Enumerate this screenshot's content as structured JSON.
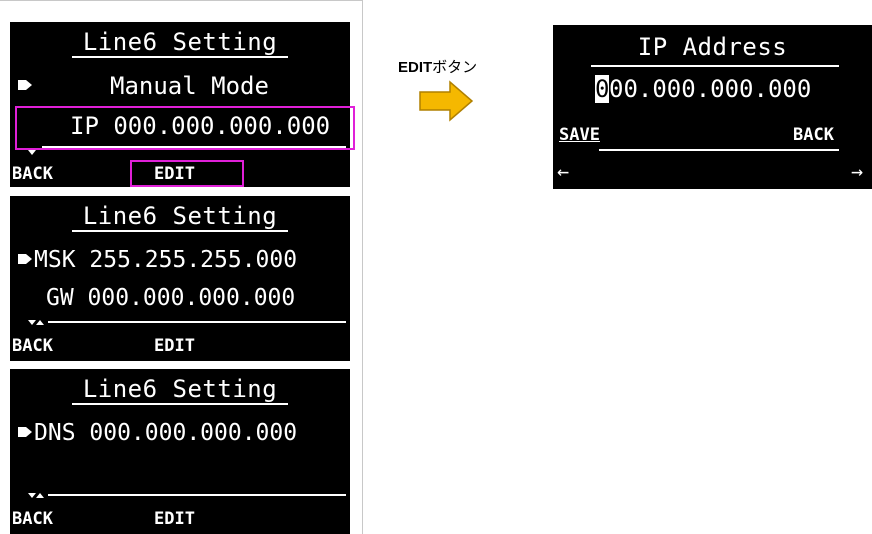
{
  "caption": {
    "bold": "EDIT",
    "rest": "ボタン"
  },
  "screen1": {
    "title": "Line6 Setting",
    "row1": "Manual Mode",
    "row2": "IP 000.000.000.000",
    "back": "BACK",
    "edit": "EDIT"
  },
  "screen2": {
    "title": "Line6 Setting",
    "row1": "MSK 255.255.255.000",
    "row2": "GW 000.000.000.000",
    "back": "BACK",
    "edit": "EDIT"
  },
  "screen3": {
    "title": "Line6 Setting",
    "row1": "DNS 000.000.000.000",
    "back": "BACK",
    "edit": "EDIT"
  },
  "screen4": {
    "title": "IP Address",
    "cursor_char": "0",
    "value_rest": "00.000.000.000",
    "save": "SAVE",
    "back": "BACK",
    "left_arrow": "←",
    "right_arrow": "→"
  },
  "colors": {
    "highlight": "#e020d8",
    "flow_arrow": "#f5b800"
  },
  "icons": [
    "selection-arrow-icon",
    "scroll-down-icon",
    "scroll-up-icon",
    "right-arrow-icon"
  ]
}
